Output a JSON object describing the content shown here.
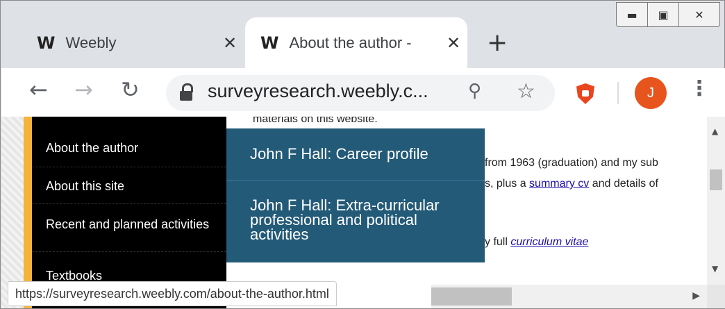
{
  "window": {
    "minimize_icon": "minimize-icon",
    "restore_icon": "restore-icon",
    "close_icon": "close-icon"
  },
  "tabs": [
    {
      "title": "Weebly",
      "icon": "weebly-logo-icon"
    },
    {
      "title": "About the author -",
      "icon": "weebly-logo-icon"
    }
  ],
  "toolbar": {
    "url": "surveyresearch.weebly.c...",
    "avatar_letter": "J"
  },
  "page": {
    "top_text": "materials on this website.",
    "nav": [
      {
        "label": "About the author"
      },
      {
        "label": "About this site"
      },
      {
        "label": "Recent and planned activities"
      },
      {
        "label": "Textbooks"
      }
    ],
    "dropdown": [
      {
        "label": "John F Hall: Career profile"
      },
      {
        "label": "John F Hall: Extra-curricular professional and political activities"
      }
    ],
    "body_line1": "from 1963 (graduation) and my sub",
    "body_line2_pre": "s, plus a",
    "body_line2_link": "summary cv",
    "body_line2_post": "and details of",
    "body_line3_pre": "y full",
    "body_line3_link": "curriculum vitae"
  },
  "status_url": "https://surveyresearch.weebly.com/about-the-author.html",
  "colors": {
    "accent": "#f4b43b",
    "dropdown": "#235a78",
    "avatar": "#e8541e",
    "nav_active_text": "#f0a030"
  }
}
